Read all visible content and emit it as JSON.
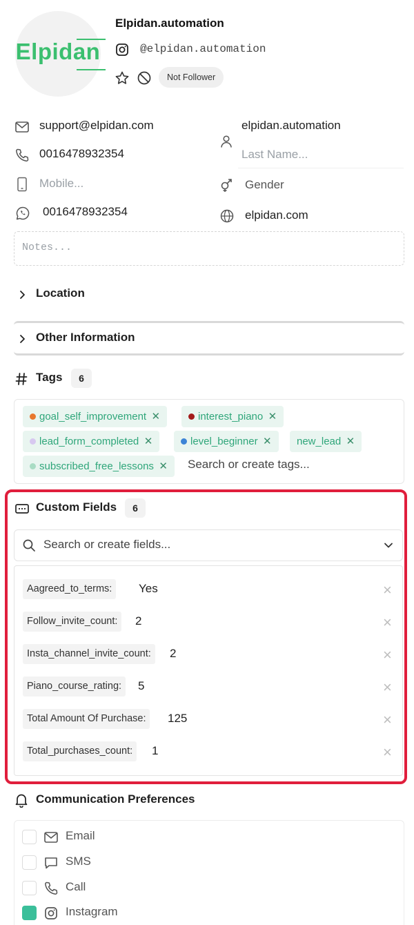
{
  "profile": {
    "avatar_logo_text": "Elpidan",
    "name": "Elpidan.automation",
    "handle": "@elpidan.automation",
    "follow_status": "Not Follower"
  },
  "contact": {
    "email": "support@elpidan.com",
    "phone": "0016478932354",
    "mobile_placeholder": "Mobile...",
    "whatsapp": "0016478932354",
    "first_name": "elpidan.automation",
    "last_name_placeholder": "Last Name...",
    "gender_placeholder": "Gender",
    "website": "elpidan.com"
  },
  "notes": {
    "placeholder": "Notes..."
  },
  "sections": {
    "location": "Location",
    "other_information": "Other Information"
  },
  "tags": {
    "title": "Tags",
    "count": "6",
    "items": [
      {
        "label": "goal_self_improvement",
        "dot_color": "#e8772e"
      },
      {
        "label": "interest_piano",
        "dot_color": "#a31b1b"
      },
      {
        "label": "lead_form_completed",
        "dot_color": "#d7c8f0"
      },
      {
        "label": "level_beginner",
        "dot_color": "#3d84d6"
      },
      {
        "label": "new_lead",
        "dot_color": ""
      },
      {
        "label": "subscribed_free_lessons",
        "dot_color": "#a9dcc4"
      }
    ],
    "search_placeholder": "Search or create tags..."
  },
  "custom_fields": {
    "title": "Custom Fields",
    "count": "6",
    "search_placeholder": "Search or create fields...",
    "items": [
      {
        "key": "Aagreed_to_terms:",
        "value": "Yes"
      },
      {
        "key": "Follow_invite_count:",
        "value": "2"
      },
      {
        "key": "Insta_channel_invite_count:",
        "value": "2"
      },
      {
        "key": "Piano_course_rating:",
        "value": "5"
      },
      {
        "key": "Total Amount Of Purchase:",
        "value": "125"
      },
      {
        "key": "Total_purchases_count:",
        "value": "1"
      }
    ]
  },
  "communication": {
    "title": "Communication Preferences",
    "items": [
      {
        "label": "Email",
        "checked": false
      },
      {
        "label": "SMS",
        "checked": false
      },
      {
        "label": "Call",
        "checked": false
      },
      {
        "label": "Instagram",
        "checked": true
      }
    ]
  },
  "colors": {
    "brand": "#3bbf6f",
    "highlight_frame": "#e01e3c",
    "tag_text": "#2fa67a",
    "tag_bg": "#e9f5f0"
  }
}
